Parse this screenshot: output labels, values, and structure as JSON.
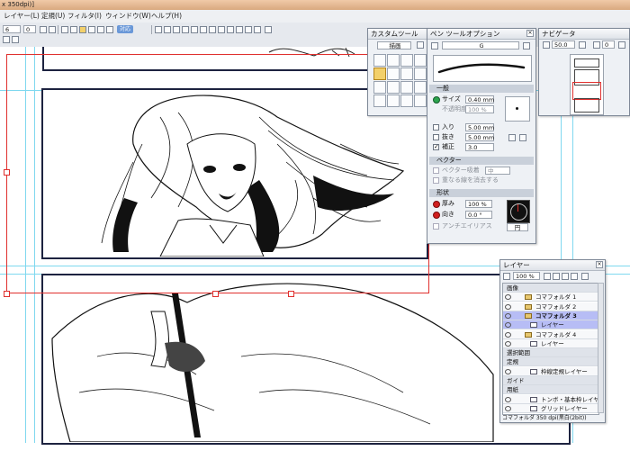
{
  "window": {
    "title_fragment": "x 350dpi)]"
  },
  "menu": [
    "レイヤー(L)",
    "定規(U)",
    "フィルタ(I)",
    "ウィンドウ(W)",
    "ヘルプ(H)"
  ],
  "toolbar": {
    "field_left": "6",
    "field_mid": "0",
    "badge": "対応"
  },
  "custom_tool": {
    "title": "カスタムツール",
    "mode": "描画",
    "tools": [
      "hand-icon",
      "rotate-icon",
      "zoom-icon",
      "loupe-icon",
      "pen-icon",
      "pencil-icon",
      "brush-icon",
      "airbrush-icon",
      "marker-icon",
      "eraser-pen-icon",
      "ink-icon",
      "fill-icon",
      "eraser-icon",
      "gradient-icon",
      "blank-icon",
      "blank-icon"
    ]
  },
  "pen_options": {
    "title": "ペン ツールオプション",
    "preset": "G",
    "sections": {
      "general": "一般",
      "vector": "ベクター",
      "shape": "形状"
    },
    "size_label": "サイズ",
    "size_value": "0.40 mm",
    "opacity_label": "不透明度",
    "opacity_value": "100 %",
    "in_label": "入り",
    "in_value": "5.00 mm",
    "out_label": "抜き",
    "out_value": "5.00 mm",
    "correction_label": "補正",
    "correction_value": "3.0",
    "vector_absorb_label": "ベクター吸着",
    "vector_absorb_value": "中",
    "erase_overlap_label": "重なる線を消去する",
    "thickness_label": "厚み",
    "thickness_value": "100 %",
    "direction_label": "向き",
    "direction_value": "0.0 °",
    "antialias_label": "アンチエイリアス",
    "shape_value": "円"
  },
  "navigator": {
    "title": "ナビゲータ",
    "zoom": "50.0",
    "rotation": "0"
  },
  "layers": {
    "title": "レイヤー",
    "opacity": "100 %",
    "rows": [
      {
        "name": "画像",
        "type": "group"
      },
      {
        "name": "コマフォルダ 1",
        "type": "folder"
      },
      {
        "name": "コマフォルダ 2",
        "type": "folder"
      },
      {
        "name": "コマフォルダ 3",
        "type": "folder"
      },
      {
        "name": "レイヤー",
        "type": "layer"
      },
      {
        "name": "コマフォルダ 4",
        "type": "folder"
      },
      {
        "name": "レイヤー",
        "type": "layer"
      },
      {
        "name": "選択範囲",
        "type": "group"
      },
      {
        "name": "定規",
        "type": "group"
      },
      {
        "name": "枠線定規レイヤー",
        "type": "layer"
      },
      {
        "name": "ガイド",
        "type": "group"
      },
      {
        "name": "用紙",
        "type": "group"
      },
      {
        "name": "トンボ・基本枠レイヤー",
        "type": "layer"
      },
      {
        "name": "グリッドレイヤー",
        "type": "layer"
      }
    ],
    "status": "コマフォルダ 350 dpi(黒白(2bit))"
  },
  "colors": {
    "accent": "#f3d06a",
    "selection": "#b7bdf5",
    "guide": "#7fd8ef",
    "red_frame": "#e0302e"
  }
}
